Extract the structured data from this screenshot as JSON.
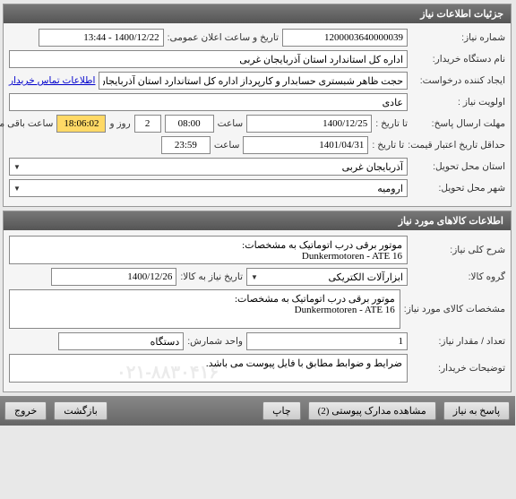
{
  "sections": {
    "need_info": {
      "title": "جزئیات اطلاعات نیاز"
    },
    "goods_info": {
      "title": "اطلاعات کالاهای مورد نیاز"
    }
  },
  "fields": {
    "need_number_lbl": "شماره نیاز:",
    "need_number": "1200003640000039",
    "announce_datetime_lbl": "تاریخ و ساعت اعلان عمومی:",
    "announce_datetime": "1400/12/22 - 13:44",
    "buyer_org_lbl": "نام دستگاه خریدار:",
    "buyer_org": "اداره کل استاندارد استان آذربایجان غربی",
    "creator_lbl": "ایجاد کننده درخواست:",
    "creator": "حجت ظاهر شبستری حسابدار و کارپرداز اداره کل استاندارد استان آذربایجان غربی",
    "contact_link": "اطلاعات تماس خریدار",
    "priority_lbl": "اولویت نیاز :",
    "priority": "عادی",
    "reply_deadline_lbl": "مهلت ارسال پاسخ:",
    "until_date_lbl": "تا تاریخ :",
    "reply_date": "1400/12/25",
    "time_lbl": "ساعت",
    "reply_time": "08:00",
    "days": "2",
    "days_and_lbl": "روز و",
    "remaining_time": "18:06:02",
    "remaining_lbl": "ساعت باقی مانده",
    "price_validity_lbl": "حداقل تاریخ اعتبار قیمت:",
    "price_date": "1401/04/31",
    "price_time": "23:59",
    "delivery_province_lbl": "استان محل تحویل:",
    "delivery_province": "آذربایجان غربی",
    "delivery_city_lbl": "شهر محل تحویل:",
    "delivery_city": "ارومیه",
    "general_desc_lbl": "شرح کلی نیاز:",
    "general_desc": "موتور برقی درب اتوماتیک به مشخصات:\nDunkermotoren - ATE 16",
    "goods_group_lbl": "گروه کالا:",
    "goods_group": "ابزارآلات الکتریکی",
    "goods_need_date_lbl": "تاریخ نیاز به کالا:",
    "goods_need_date": "1400/12/26",
    "goods_spec_lbl": "مشخصات کالای مورد نیاز:",
    "goods_spec": "موتور برقی درب اتوماتیک به مشخصات:\nDunkermotoren - ATE 16",
    "qty_lbl": "تعداد / مقدار نیاز:",
    "qty": "1",
    "unit_lbl": "واحد شمارش:",
    "unit": "دستگاه",
    "buyer_note_lbl": "توضیحات خریدار:",
    "buyer_note": "ضرایط و ضوابط مطابق با فایل پیوست می باشد."
  },
  "buttons": {
    "reply": "پاسخ به نیاز",
    "attachments": "مشاهده مدارک پیوستی (2)",
    "print": "چاپ",
    "back": "بازگشت",
    "exit": "خروج"
  },
  "watermark": "۰۲۱-۸۸۳۰۴۱۶"
}
